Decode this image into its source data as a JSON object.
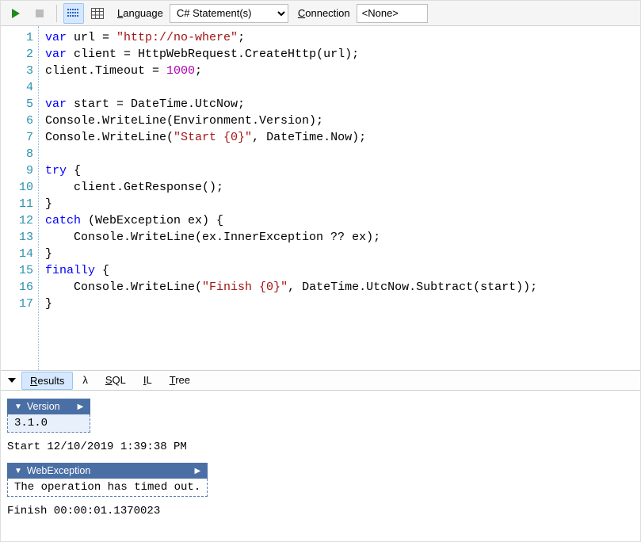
{
  "toolbar": {
    "language_label": "Language",
    "language_value": "C# Statement(s)",
    "connection_label": "Connection",
    "connection_value": "<None>"
  },
  "code": {
    "lines": [
      [
        [
          "kw",
          "var"
        ],
        [
          "",
          " url = "
        ],
        [
          "str",
          "\"http://no-where\""
        ],
        [
          "",
          ";"
        ]
      ],
      [
        [
          "kw",
          "var"
        ],
        [
          "",
          " client = HttpWebRequest.CreateHttp(url);"
        ]
      ],
      [
        [
          "",
          "client.Timeout = "
        ],
        [
          "num",
          "1000"
        ],
        [
          "",
          ";"
        ]
      ],
      [
        [
          "",
          ""
        ]
      ],
      [
        [
          "kw",
          "var"
        ],
        [
          "",
          " start = DateTime.UtcNow;"
        ]
      ],
      [
        [
          "",
          "Console.WriteLine(Environment.Version);"
        ]
      ],
      [
        [
          "",
          "Console.WriteLine("
        ],
        [
          "str",
          "\"Start {0}\""
        ],
        [
          "",
          ", DateTime.Now);"
        ]
      ],
      [
        [
          "",
          ""
        ]
      ],
      [
        [
          "kw",
          "try"
        ],
        [
          "",
          " {"
        ]
      ],
      [
        [
          "",
          "    client.GetResponse();"
        ]
      ],
      [
        [
          "",
          "}"
        ]
      ],
      [
        [
          "kw",
          "catch"
        ],
        [
          "",
          " (WebException ex) {"
        ]
      ],
      [
        [
          "",
          "    Console.WriteLine(ex.InnerException ?? ex);"
        ]
      ],
      [
        [
          "",
          "}"
        ]
      ],
      [
        [
          "kw",
          "finally"
        ],
        [
          "",
          " {"
        ]
      ],
      [
        [
          "",
          "    Console.WriteLine("
        ],
        [
          "str",
          "\"Finish {0}\""
        ],
        [
          "",
          ", DateTime.UtcNow.Subtract(start));"
        ]
      ],
      [
        [
          "",
          "}"
        ]
      ]
    ]
  },
  "tabs": {
    "items": [
      "Results",
      "λ",
      "SQL",
      "IL",
      "Tree"
    ],
    "active_index": 0
  },
  "results": {
    "version_header": "Version",
    "version_value": "3.1.0",
    "start_line": "Start 12/10/2019 1:39:38 PM",
    "exception_header": "WebException",
    "exception_value": "The operation has timed out.",
    "finish_line": "Finish 00:00:01.1370023"
  }
}
